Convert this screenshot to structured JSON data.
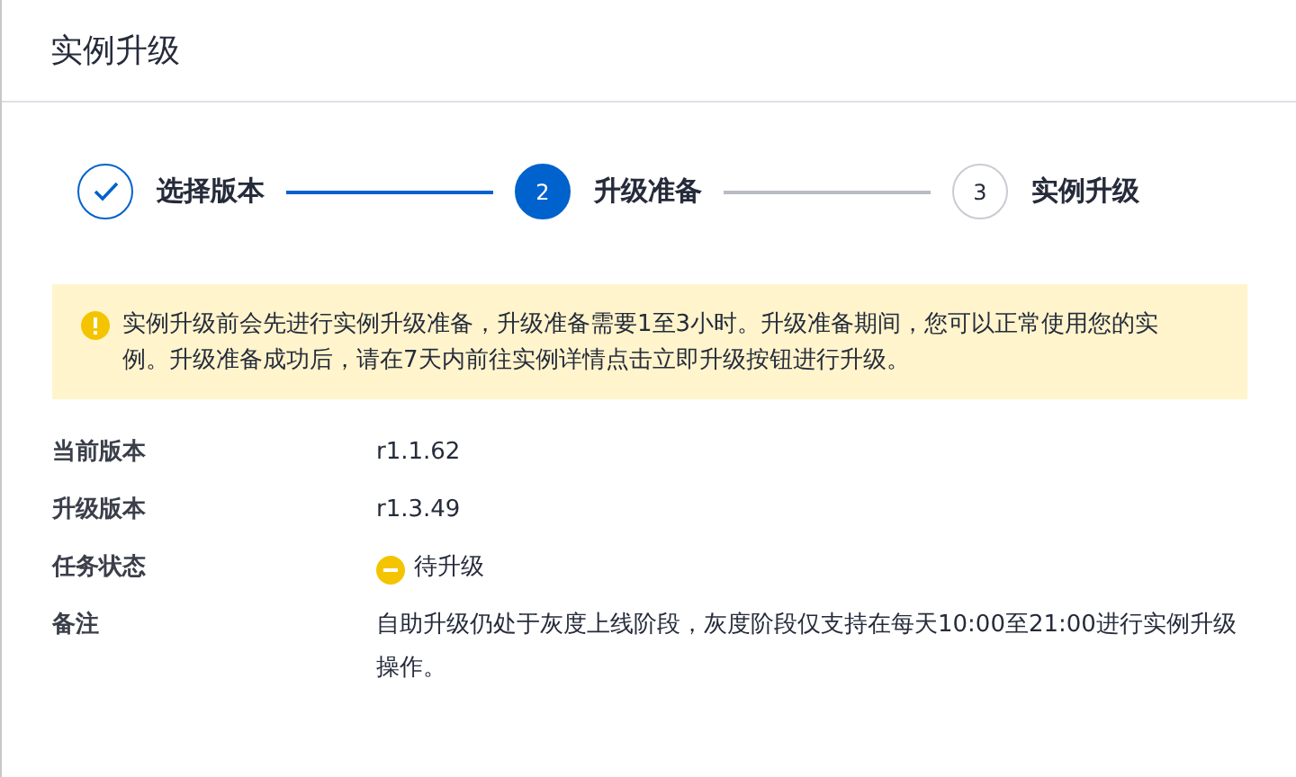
{
  "dialog": {
    "title": "实例升级"
  },
  "steps": [
    {
      "kind": "done",
      "label": "选择版本"
    },
    {
      "kind": "current",
      "number": "2",
      "label": "升级准备"
    },
    {
      "kind": "pending",
      "number": "3",
      "label": "实例升级"
    }
  ],
  "alert": {
    "text": "实例升级前会先进行实例升级准备，升级准备需要1至3小时。升级准备期间，您可以正常使用您的实例。升级准备成功后，请在7天内前往实例详情点击立即升级按钮进行升级。"
  },
  "fields": [
    {
      "kind": "text",
      "label": "当前版本",
      "value": "r1.1.62"
    },
    {
      "kind": "text",
      "label": "升级版本",
      "value": "r1.3.49"
    },
    {
      "kind": "status",
      "label": "任务状态",
      "value": "待升级",
      "color": "#f5c400"
    },
    {
      "kind": "text",
      "label": "备注",
      "value": "自助升级仍处于灰度上线阶段，灰度阶段仅支持在每天10:00至21:00进行实例升级操作。"
    }
  ]
}
